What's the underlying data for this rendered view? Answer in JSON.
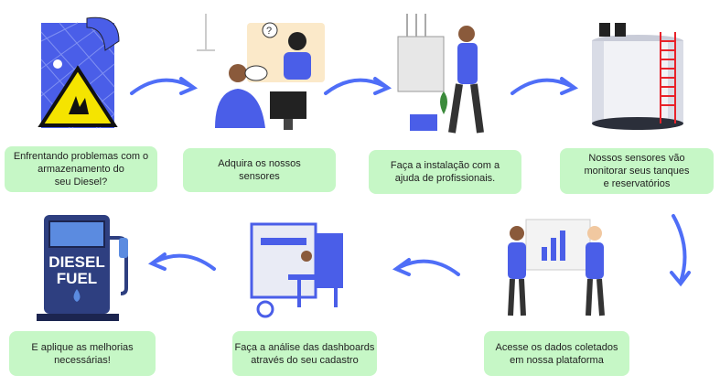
{
  "steps": [
    {
      "label": "Enfrentando problemas com o\narmazenamento do\nseu Diesel?"
    },
    {
      "label": "Adquira os nossos\nsensores"
    },
    {
      "label": "Faça a instalação com a\najuda de profissionais."
    },
    {
      "label": "Nossos sensores vão\nmonitorar seus tanques\ne reservatórios"
    },
    {
      "label": "Acesse os dados coletados\nem nossa plataforma"
    },
    {
      "label": "Faça a análise das dashboards\natravés do seu cadastro"
    },
    {
      "label": "E aplique as melhorias\nnecessárias!"
    }
  ],
  "fuel_pump": {
    "line1": "DIESEL",
    "line2": "FUEL"
  },
  "colors": {
    "box": "#c6f7c6",
    "arrow": "#4f6ef7",
    "accent": "#3b5bdb"
  }
}
